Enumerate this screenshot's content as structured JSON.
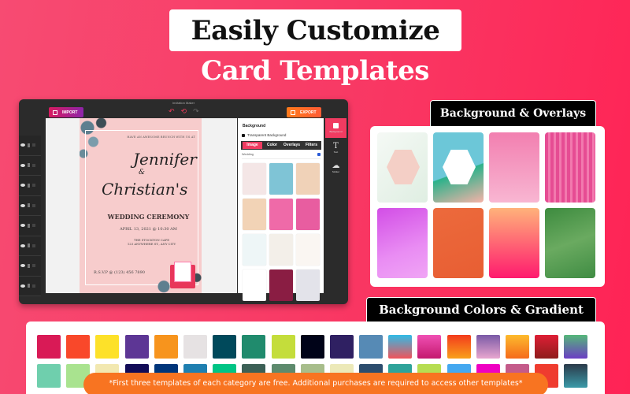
{
  "headline": "Easily Customize",
  "subheadline": "Card Templates",
  "editor": {
    "window_title": "Invitation Maker",
    "import_label": "IMPORT",
    "export_label": "EXPORT",
    "history": {
      "undo": "↶",
      "reset": "⟲",
      "redo": "↷"
    },
    "layer_count": 8,
    "card": {
      "tagline": "HAVE AN AWESOME BRUNCH WITH US AT",
      "name1": "Jennifer",
      "ampersand": "&",
      "name2": "Christian's",
      "event": "WEDDING CEREMONY",
      "datetime": "APRIL 13, 2021 @ 10:30 AM",
      "venue_line1": "THE STOCKTON CAFE",
      "venue_line2": "123 ANYWHERE ST., ANY CITY",
      "rsvp": "R.S.V.P @ (123) 456 7890"
    },
    "panel": {
      "title": "Background",
      "transparent_label": "Transparent Background",
      "tabs": [
        {
          "label": "Image",
          "active": true
        },
        {
          "label": "Color",
          "active": false
        },
        {
          "label": "Overlays",
          "active": false
        },
        {
          "label": "Filters",
          "active": false
        }
      ],
      "category_selected": "Wedding",
      "thumbnails": [
        "#f4e6e6",
        "#7fc4d6",
        "#f0d2b8",
        "#f2d3b6",
        "#ef6aa8",
        "#e85da0",
        "#eef6f7",
        "#f3efe9",
        "#faf6f2",
        "#ffffff",
        "#8a1d43",
        "#e3e3ea"
      ]
    },
    "tools": [
      {
        "label": "Background",
        "glyph": "",
        "active": true
      },
      {
        "label": "Text",
        "glyph": "T",
        "active": false
      },
      {
        "label": "Sticker",
        "glyph": "☁",
        "active": false
      }
    ]
  },
  "overlays_section": {
    "title": "Background & Overlays",
    "items": [
      {
        "name": "palm-hexagon",
        "bg": "linear-gradient(135deg,#f5f9f5,#dfeee2)",
        "hex": "#f4cfc6"
      },
      {
        "name": "floral-hexagon",
        "bg": "linear-gradient(160deg,#6cc7d8 0%,#6cc7d8 55%,#2bb28a 56%,#f6b2a8 100%)",
        "hex": "#ffffff"
      },
      {
        "name": "bride-dress",
        "bg": "linear-gradient(180deg,#f27fb0,#f8b6d2)",
        "hex": ""
      },
      {
        "name": "pink-stripes",
        "bg": "repeating-linear-gradient(90deg,#e64c93 0 4px,#f279ae 4px 7px)",
        "hex": ""
      },
      {
        "name": "purple-watercolor",
        "bg": "linear-gradient(160deg,#d24ee6,#e98cf3 60%,#f0a5f5)",
        "hex": ""
      },
      {
        "name": "orange-texture",
        "bg": "linear-gradient(160deg,#ec6a3c,#e85e33)",
        "hex": ""
      },
      {
        "name": "peach-pink-gradient",
        "bg": "linear-gradient(180deg,#ffb27a,#ff1a6e)",
        "hex": ""
      },
      {
        "name": "green-watercolor",
        "bg": "linear-gradient(160deg,#3d8b3f,#6aaa60 50%,#3f8c43)",
        "hex": ""
      }
    ]
  },
  "colors_section": {
    "title": "Background Colors & Gradient",
    "swatches_row1": [
      "#d91a56",
      "#f9482a",
      "#fde129",
      "#5d3695",
      "#f7941d",
      "#e6e2e3",
      "#00495b",
      "#208b6d",
      "#c4dd3b",
      "#000318",
      "#2f2062",
      "#568ab5",
      "linear-gradient(180deg,#30bbe6,#f0535a)",
      "linear-gradient(180deg,#f050b4,#c4196e)",
      "linear-gradient(180deg,#f33b1c,#f9a01b)",
      "linear-gradient(180deg,#7a5aa6,#e8a6cf)",
      "linear-gradient(180deg,#fdbb2d,#f56a1c)",
      "linear-gradient(180deg,#de1f35,#8e1c1c)",
      "linear-gradient(180deg,#55b77a,#6b3ec4)"
    ],
    "swatches_row2": [
      "#6fcfad",
      "#a9e38f",
      "#f2e8b0",
      "#120c57",
      "#00357a",
      "#1f7fb0",
      "#00c585",
      "#3c6056",
      "#5d8a6d",
      "#a7bd8b",
      "#ece9b8",
      "#2c4d6e",
      "#2ea39a",
      "#b6dd52",
      "#44a8f0",
      "#ef00c2",
      "#c45b8a",
      "#ef3c2f",
      "linear-gradient(180deg,#2b3a4a,#3b9aa8)"
    ],
    "notice": "*First three templates of each category are free. Additional purchases are required to access other templates*"
  }
}
